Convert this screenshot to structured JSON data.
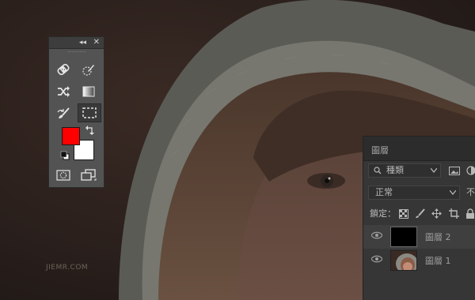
{
  "canvas": {
    "background_color": "#2a211f",
    "watermark_text": "JIEMR.COM"
  },
  "tools_panel": {
    "collapse_icon": "double-chevron-left-icon",
    "close_icon": "close-icon",
    "tools": [
      {
        "name": "healing-brush-icon"
      },
      {
        "name": "quick-selection-icon"
      },
      {
        "name": "crop-transform-icon"
      },
      {
        "name": "gradient-icon"
      },
      {
        "name": "history-brush-icon"
      },
      {
        "name": "rectangular-marquee-icon",
        "active": true
      }
    ],
    "foreground_color": "#ff0000",
    "background_color": "#ffffff",
    "swap_icon": "swap-colors-icon",
    "default_colors_icon": "default-colors-icon",
    "quick_mask_icon": "quick-mask-icon",
    "screen_mode_icon": "screen-mode-icon"
  },
  "layers_panel": {
    "title": "圖層",
    "filter_label": "種類",
    "blend_mode": "正常",
    "opacity_label": "不",
    "lock_label": "鎖定：",
    "layers": [
      {
        "name": "圖層 2",
        "visible": true,
        "thumbnail": "black"
      },
      {
        "name": "圖層 1",
        "visible": true,
        "thumbnail": "photo"
      }
    ]
  }
}
